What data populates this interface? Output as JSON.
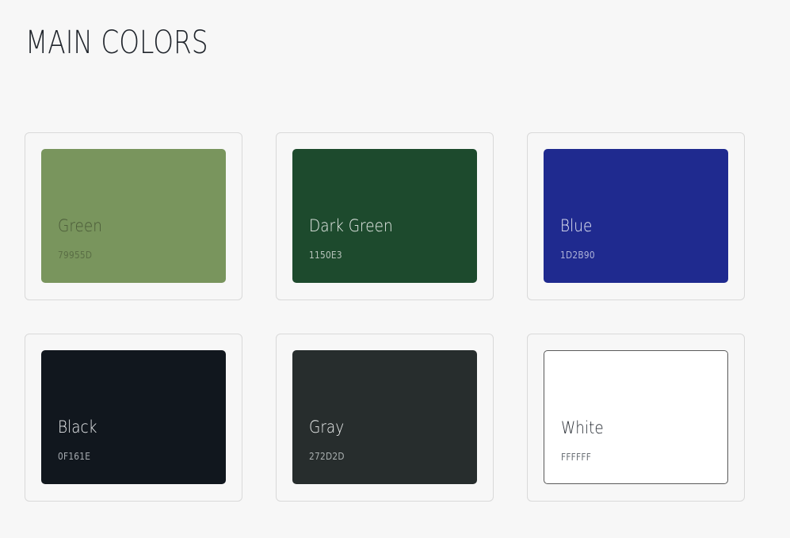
{
  "page": {
    "title": "MAIN COLORS"
  },
  "swatches": [
    {
      "name": "Green",
      "hex_label": "79955D",
      "color": "#79955d",
      "name_color": "#4a5a38",
      "hex_color": "#5a6e45"
    },
    {
      "name": "Dark Green",
      "hex_label": "1150E3",
      "color": "#1d4a2d",
      "name_color": "#e8ece9",
      "hex_color": "#b8c4bc"
    },
    {
      "name": "Blue",
      "hex_label": "1D2B90",
      "color": "#1f2a8f",
      "name_color": "#e7e9f4",
      "hex_color": "#aeb3d8"
    },
    {
      "name": "Black",
      "hex_label": "0F161E",
      "color": "#11171e",
      "name_color": "#eceef0",
      "hex_color": "#a7acb1"
    },
    {
      "name": "Gray",
      "hex_label": "272D2D",
      "color": "#272d2d",
      "name_color": "#eceeee",
      "hex_color": "#aab0b0"
    },
    {
      "name": "White",
      "hex_label": "FFFFFF",
      "color": "#ffffff",
      "name_color": "#2a2f36",
      "hex_color": "#6a6f75"
    }
  ]
}
